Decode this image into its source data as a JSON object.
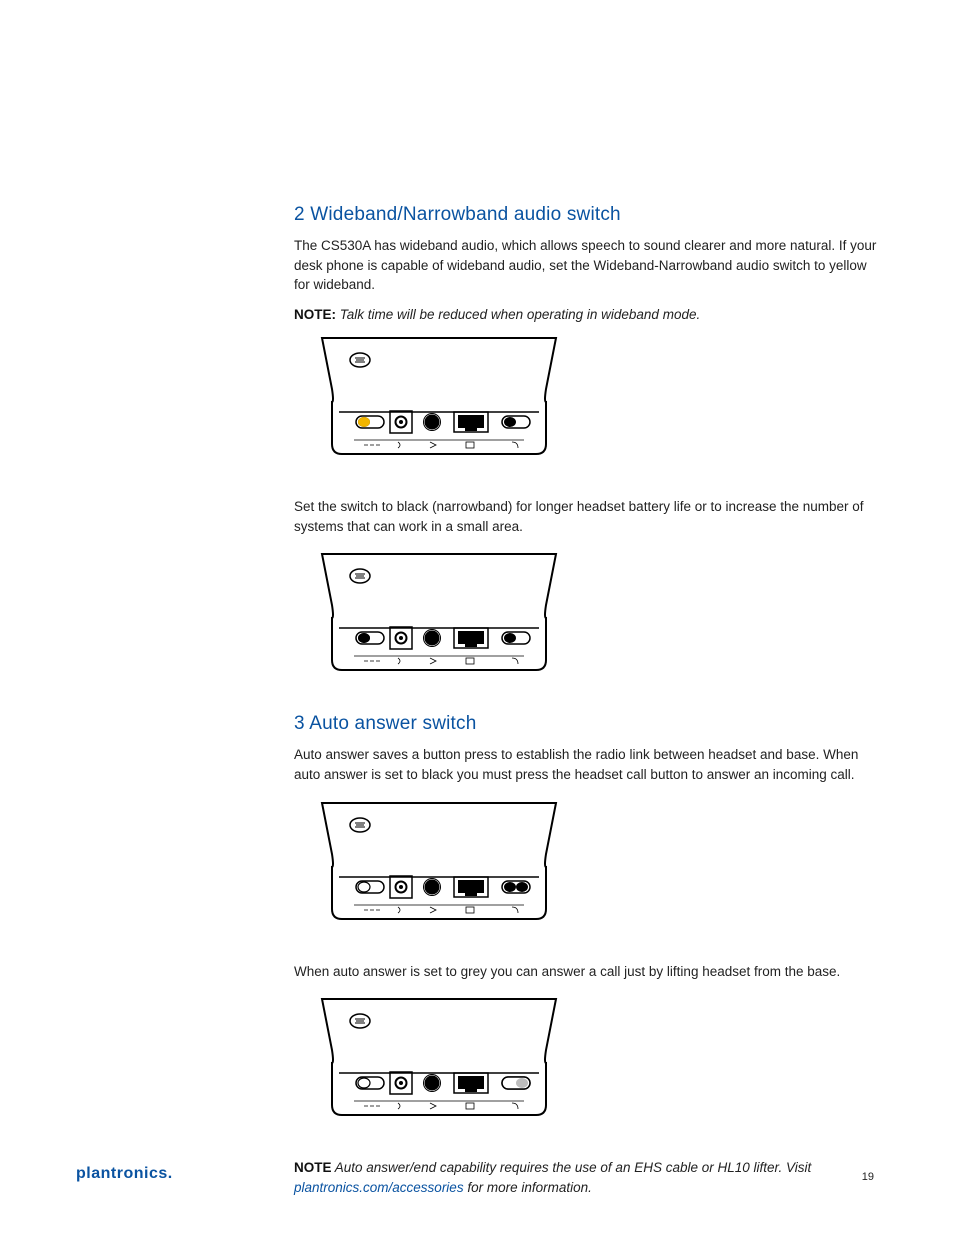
{
  "section2": {
    "heading": "2 Wideband/Narrowband audio switch",
    "para1": "The CS530A has wideband audio, which allows speech to sound clearer and more natural. If your desk phone is capable of wideband audio, set the Wideband-Narrowband audio switch to yellow for wideband.",
    "note1_label": "NOTE:",
    "note1_text": " Talk time will be reduced when operating in wideband mode.",
    "para2": "Set the switch to black (narrowband) for longer headset battery life or to increase the number of systems that can work in a small area."
  },
  "diagram": {
    "switch_wideband_color": "#f2b600",
    "switch_narrowband_color": "#000000",
    "switch_auto_black": "#000000",
    "switch_auto_grey": "#bdbdbd"
  },
  "section3": {
    "heading": "3 Auto answer switch",
    "para1": "Auto answer saves a button press to establish the radio link between headset and base. When auto answer is set to black you must press the headset call button to answer an incoming call.",
    "para2": "When auto answer is set to grey you can answer a call just by lifting headset from the base.",
    "note2_label": "NOTE",
    "note2_text": " Auto answer/end capability requires the use of an EHS cable or HL10 lifter. Visit ",
    "note2_link": "plantronics.com/accessories",
    "note2_tail": " for more information."
  },
  "footer": {
    "brand": "plantronics",
    "page": "19"
  }
}
